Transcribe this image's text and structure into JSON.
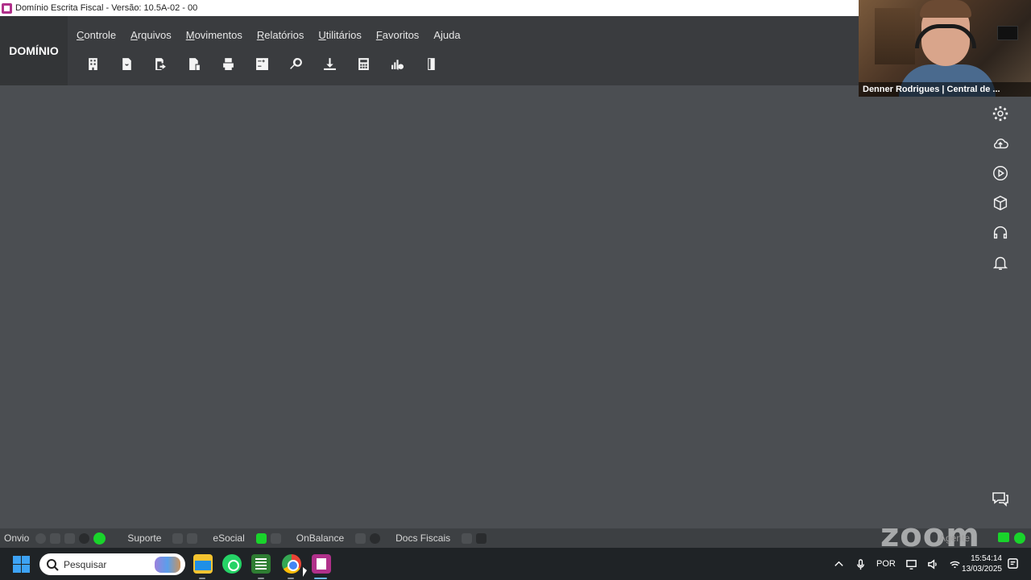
{
  "window": {
    "title": "Domínio Escrita Fiscal  - Versão: 10.5A-02 - 00"
  },
  "brand": {
    "name": "DOMÍNIO"
  },
  "menu": [
    {
      "label_u": "C",
      "label_rest": "ontrole"
    },
    {
      "label_u": "A",
      "label_rest": "rquivos"
    },
    {
      "label_u": "M",
      "label_rest": "ovimentos"
    },
    {
      "label_u": "R",
      "label_rest": "elatórios"
    },
    {
      "label_u": "U",
      "label_rest": "tilitários"
    },
    {
      "label_u": "F",
      "label_rest": "avoritos"
    },
    {
      "label_u": "",
      "label_rest": "Ajuda"
    }
  ],
  "toolbar_icons": [
    "building-icon",
    "refresh-document-icon",
    "document-export-icon",
    "document-money-icon",
    "printer-icon",
    "calculation-sheet-icon",
    "search-icon",
    "download-icon",
    "calculator-icon",
    "chart-search-icon",
    "book-icon"
  ],
  "webcam": {
    "caption": "Denner Rodrigues | Central de ..."
  },
  "side_icons": [
    "gear-icon",
    "cloud-upload-icon",
    "play-icon",
    "cube-icon",
    "headset-icon",
    "bell-icon"
  ],
  "status": {
    "onvio": "Onvio",
    "suporte": "Suporte",
    "esocial": "eSocial",
    "onbalance": "OnBalance",
    "docs_fiscais": "Docs Fiscais",
    "agente": "Agente",
    "zoom_logo": "zoom"
  },
  "taskbar": {
    "search_placeholder": "Pesquisar",
    "language": "POR",
    "time": "15:54:14",
    "date": "13/03/2025"
  },
  "colors": {
    "workspace": "#4b4e52",
    "header": "#3a3c3f",
    "status_green": "#19d42b",
    "app_accent": "#b0308a"
  }
}
